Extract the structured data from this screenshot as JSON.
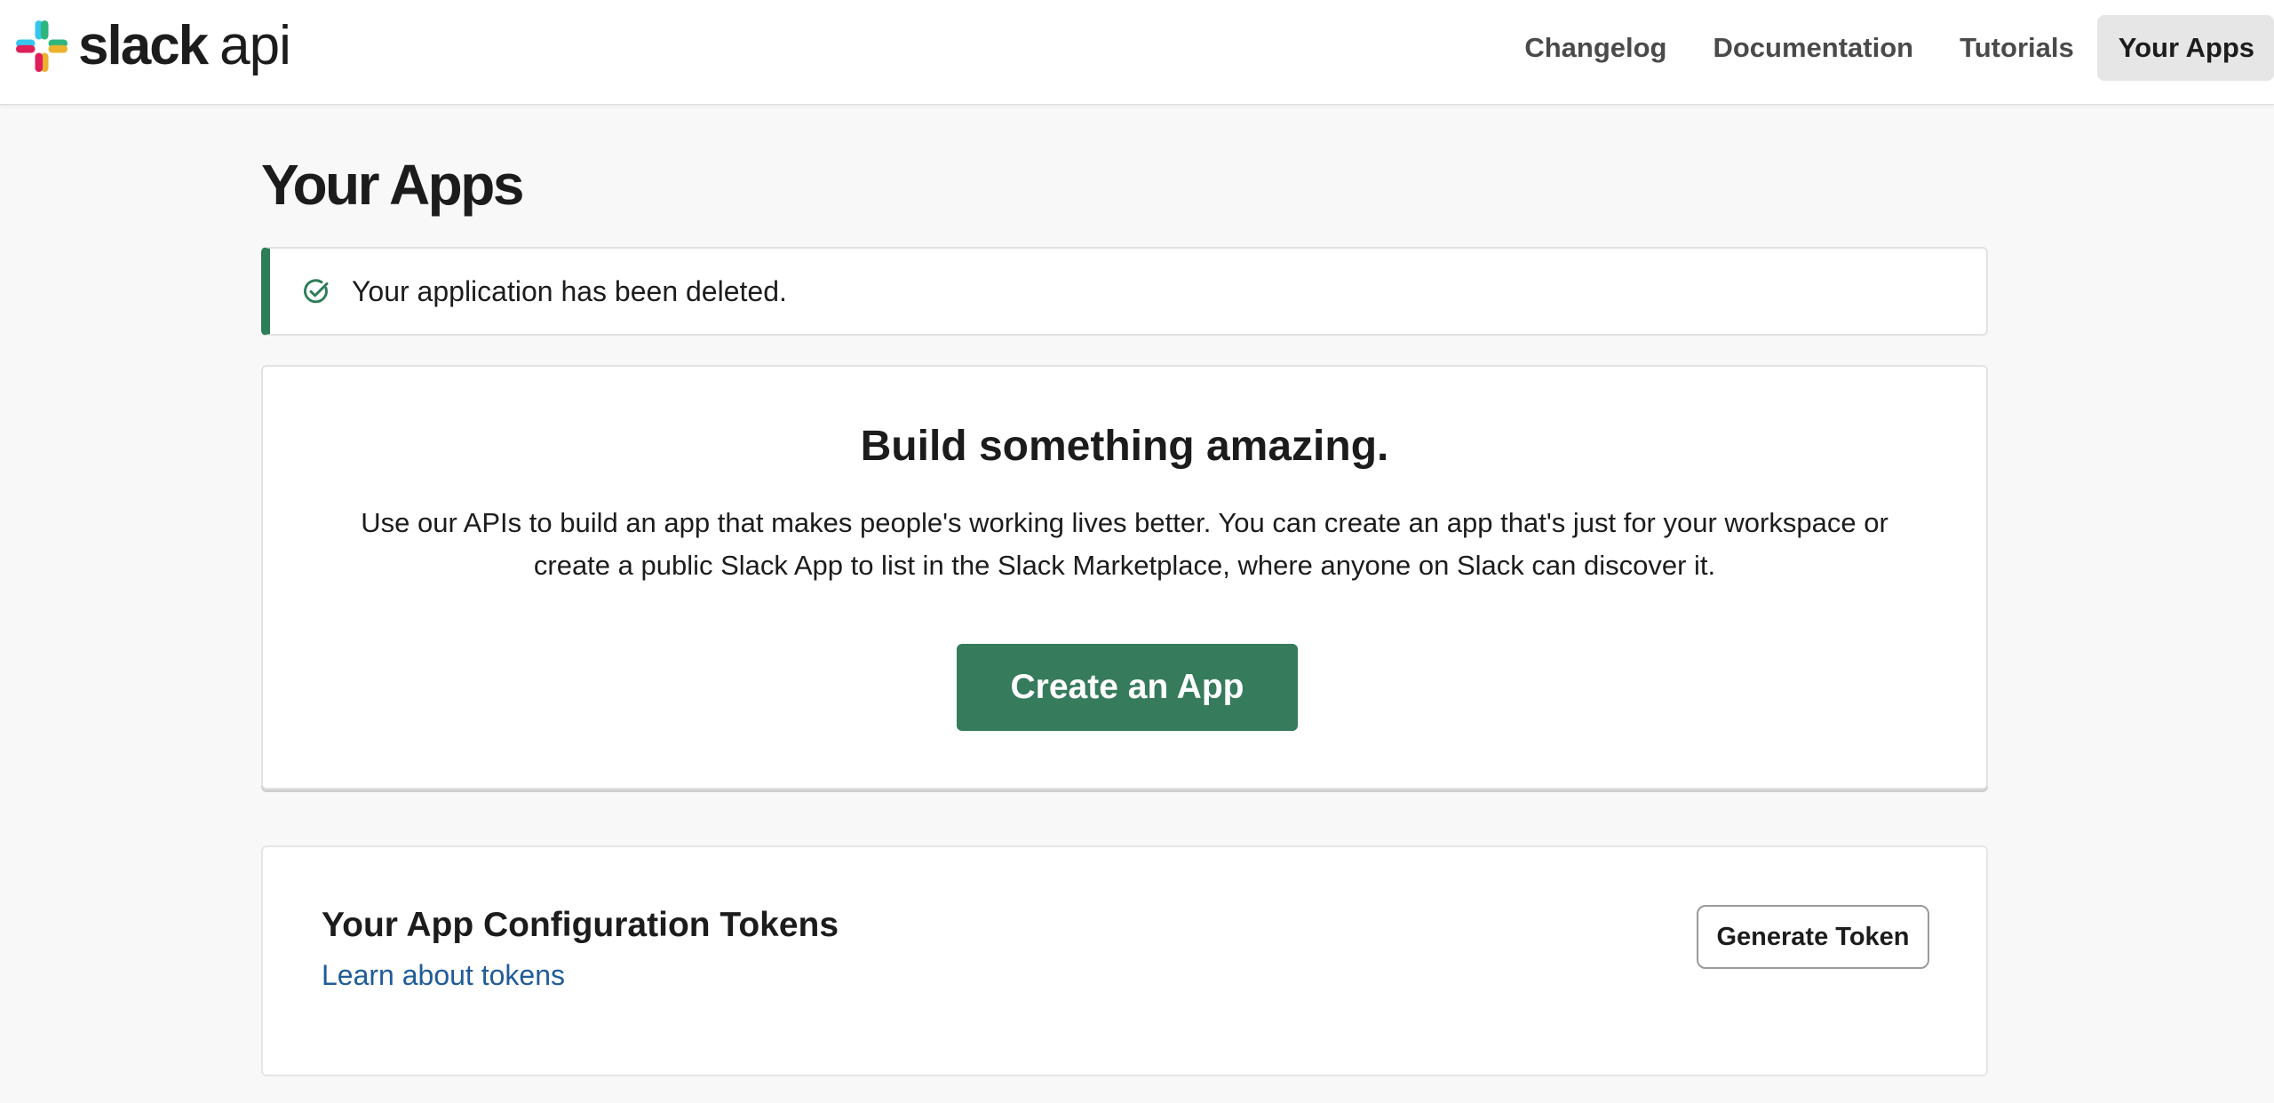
{
  "brand": {
    "wordmark": "slack",
    "suffix": "api",
    "logo_icon": "slack-hash-logo",
    "logo_colors": [
      "#36C5F0",
      "#2EB67D",
      "#ECB22E",
      "#E01E5A"
    ]
  },
  "nav": {
    "items": [
      {
        "label": "Changelog"
      },
      {
        "label": "Documentation"
      },
      {
        "label": "Tutorials"
      },
      {
        "label": "Your Apps",
        "active": true
      }
    ]
  },
  "page": {
    "title": "Your Apps"
  },
  "alert": {
    "icon": "check-circle-icon",
    "message": "Your application has been deleted.",
    "accent_color": "#2E7D59"
  },
  "build": {
    "title": "Build something amazing.",
    "description": "Use our APIs to build an app that makes people's working lives better. You can create an app that's just for your workspace or create a public Slack App to list in the Slack Marketplace, where anyone on Slack can discover it.",
    "create_button_label": "Create an App",
    "button_color": "#357B5C"
  },
  "tokens": {
    "title": "Your App Configuration Tokens",
    "learn_link": "Learn about tokens",
    "generate_button_label": "Generate Token"
  }
}
